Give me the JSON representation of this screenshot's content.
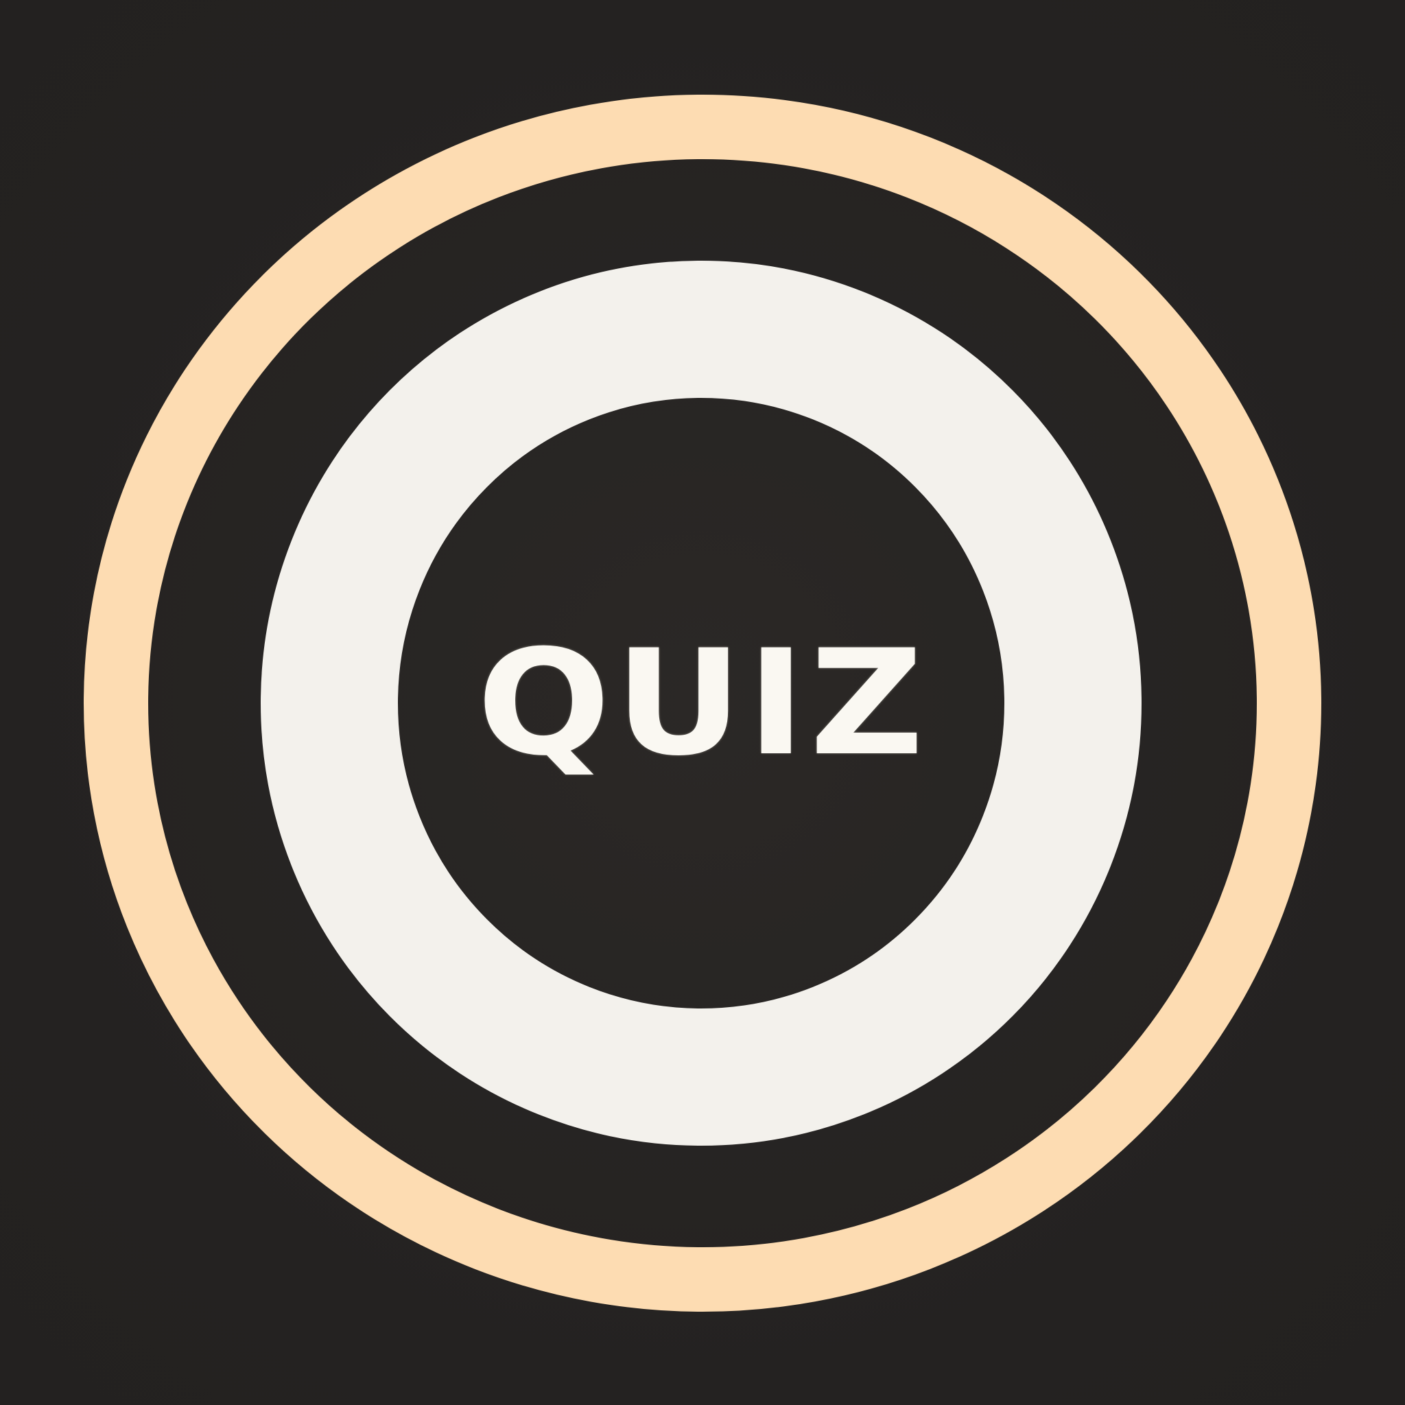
{
  "logo": {
    "text": "QUIZ",
    "colors": {
      "background": "#252322",
      "outer_ring": "#fddcb2",
      "inner_ring": "#f3f1ec",
      "text": "#faf8f2"
    }
  }
}
